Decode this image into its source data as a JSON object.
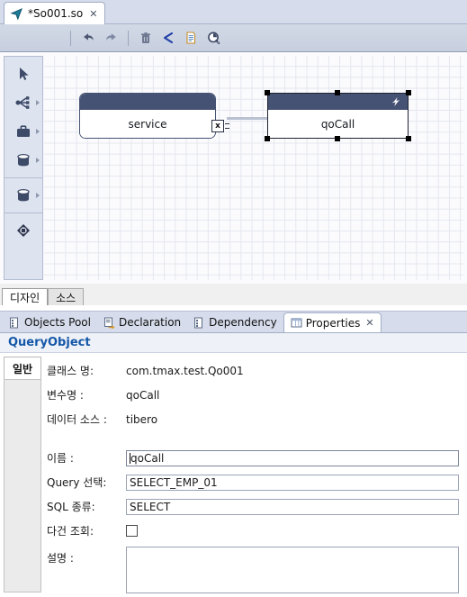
{
  "editor": {
    "tab": {
      "title": "*So001.so",
      "icon": "cursor-arrow-icon",
      "close": "✕"
    },
    "toolbar": {
      "buttons": [
        {
          "name": "undo-button",
          "icon": "undo-arrow-icon",
          "label": "Undo"
        },
        {
          "name": "redo-button",
          "icon": "redo-arrow-icon",
          "label": "Redo"
        },
        {
          "name": "delete-button",
          "icon": "trash-icon",
          "label": "Delete"
        },
        {
          "name": "connection-button",
          "icon": "share-icon",
          "label": "Connection"
        },
        {
          "name": "document-button",
          "icon": "document-icon",
          "label": "Document"
        },
        {
          "name": "query-search-button",
          "icon": "query-magnifier-icon",
          "label": "Query Search"
        }
      ]
    },
    "palette": {
      "groups": [
        {
          "items": [
            {
              "name": "palette-select-tool",
              "icon": "cursor-arrow-icon",
              "more": false
            },
            {
              "name": "palette-branch-tool",
              "icon": "branch-split-icon",
              "more": true
            },
            {
              "name": "palette-service-tool",
              "icon": "briefcase-icon",
              "more": true
            },
            {
              "name": "palette-datasource-tool",
              "icon": "database-cylinder-icon",
              "more": true
            }
          ]
        },
        {
          "items": [
            {
              "name": "palette-query-tool",
              "icon": "database-cylinder-icon",
              "more": true
            }
          ]
        },
        {
          "items": [
            {
              "name": "palette-node-tool",
              "icon": "diamond-node-icon",
              "more": false
            }
          ]
        }
      ]
    },
    "diagram": {
      "nodes": [
        {
          "name": "node-service",
          "label": "service",
          "badge": "x",
          "selected": false
        },
        {
          "name": "node-qocall",
          "label": "qoCall",
          "badge_icon": "lightning-bolt-icon",
          "selected": true
        }
      ]
    },
    "design_tabs": [
      {
        "name": "design-tab-design",
        "label": "디자인",
        "active": true
      },
      {
        "name": "design-tab-source",
        "label": "소스",
        "active": false
      }
    ]
  },
  "properties_view": {
    "tabs": [
      {
        "name": "tab-objects-pool",
        "label": "Objects Pool",
        "icon": "objects-pool-icon",
        "active": false
      },
      {
        "name": "tab-declaration",
        "label": "Declaration",
        "icon": "declaration-icon",
        "active": false
      },
      {
        "name": "tab-dependency",
        "label": "Dependency",
        "icon": "dependency-icon",
        "active": false
      },
      {
        "name": "tab-properties",
        "label": "Properties",
        "icon": "properties-icon",
        "active": true,
        "close": "✕"
      }
    ],
    "title": "QueryObject",
    "side_tabs": [
      {
        "name": "side-tab-general",
        "label": "일반",
        "active": true
      }
    ],
    "readonly_rows": [
      {
        "label": "클래스 명:",
        "value": "com.tmax.test.Qo001"
      },
      {
        "label": "변수명 :",
        "value": "qoCall"
      },
      {
        "label": "데이터 소스 :",
        "value": "tibero"
      }
    ],
    "fields": {
      "name": {
        "label": "이름 :",
        "value": "qoCall",
        "focused": true
      },
      "query_select": {
        "label": "Query 선택:",
        "value": "SELECT_EMP_01"
      },
      "sql_type": {
        "label": "SQL 종류:",
        "value": "SELECT"
      },
      "multi_row": {
        "label": "다건 조회:",
        "checked": false
      },
      "description": {
        "label": "설명 :",
        "value": ""
      }
    }
  },
  "colors": {
    "node_header": "#465274",
    "toolbar_bg": "#ccd3e0",
    "title_accent": "#1457a8",
    "tab_icon_teal": "#1d7a99"
  }
}
